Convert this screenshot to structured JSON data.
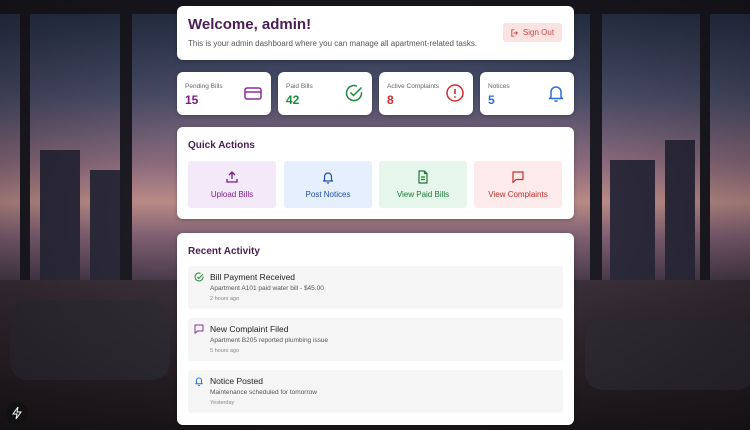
{
  "welcome": {
    "title": "Welcome, admin!",
    "subtitle": "This is your admin dashboard where you can manage all apartment-related tasks.",
    "signout_label": "Sign Out"
  },
  "stats": [
    {
      "label": "Pending Bills",
      "value": "15",
      "color": "#7a1d86",
      "icon": "card-icon"
    },
    {
      "label": "Paid Bills",
      "value": "42",
      "color": "#1c8a3a",
      "icon": "check-circle-icon"
    },
    {
      "label": "Active Complaints",
      "value": "8",
      "color": "#d12b2b",
      "icon": "alert-circle-icon"
    },
    {
      "label": "Notices",
      "value": "5",
      "color": "#2d6fd6",
      "icon": "bell-icon"
    }
  ],
  "quick_actions": {
    "title": "Quick Actions",
    "items": [
      {
        "label": "Upload Bills",
        "bg": "#f4e9f8",
        "color": "#7a1d86",
        "icon": "upload-icon"
      },
      {
        "label": "Post Notices",
        "bg": "#e6effd",
        "color": "#1d4fb0",
        "icon": "bell-icon"
      },
      {
        "label": "View Paid Bills",
        "bg": "#e6f6ea",
        "color": "#1c7a38",
        "icon": "document-icon"
      },
      {
        "label": "View Complaints",
        "bg": "#fdeaea",
        "color": "#c23030",
        "icon": "message-icon"
      }
    ]
  },
  "recent_activity": {
    "title": "Recent Activity",
    "items": [
      {
        "title": "Bill Payment Received",
        "detail": "Apartment A101 paid water bill - $45.00",
        "time": "2 hours ago",
        "icon": "check-circle-icon"
      },
      {
        "title": "New Complaint Filed",
        "detail": "Apartment B205 reported plumbing issue",
        "time": "5 hours ago",
        "icon": "message-icon"
      },
      {
        "title": "Notice Posted",
        "detail": "Maintenance scheduled for tomorrow",
        "time": "Yesterday",
        "icon": "bell-icon"
      }
    ]
  }
}
